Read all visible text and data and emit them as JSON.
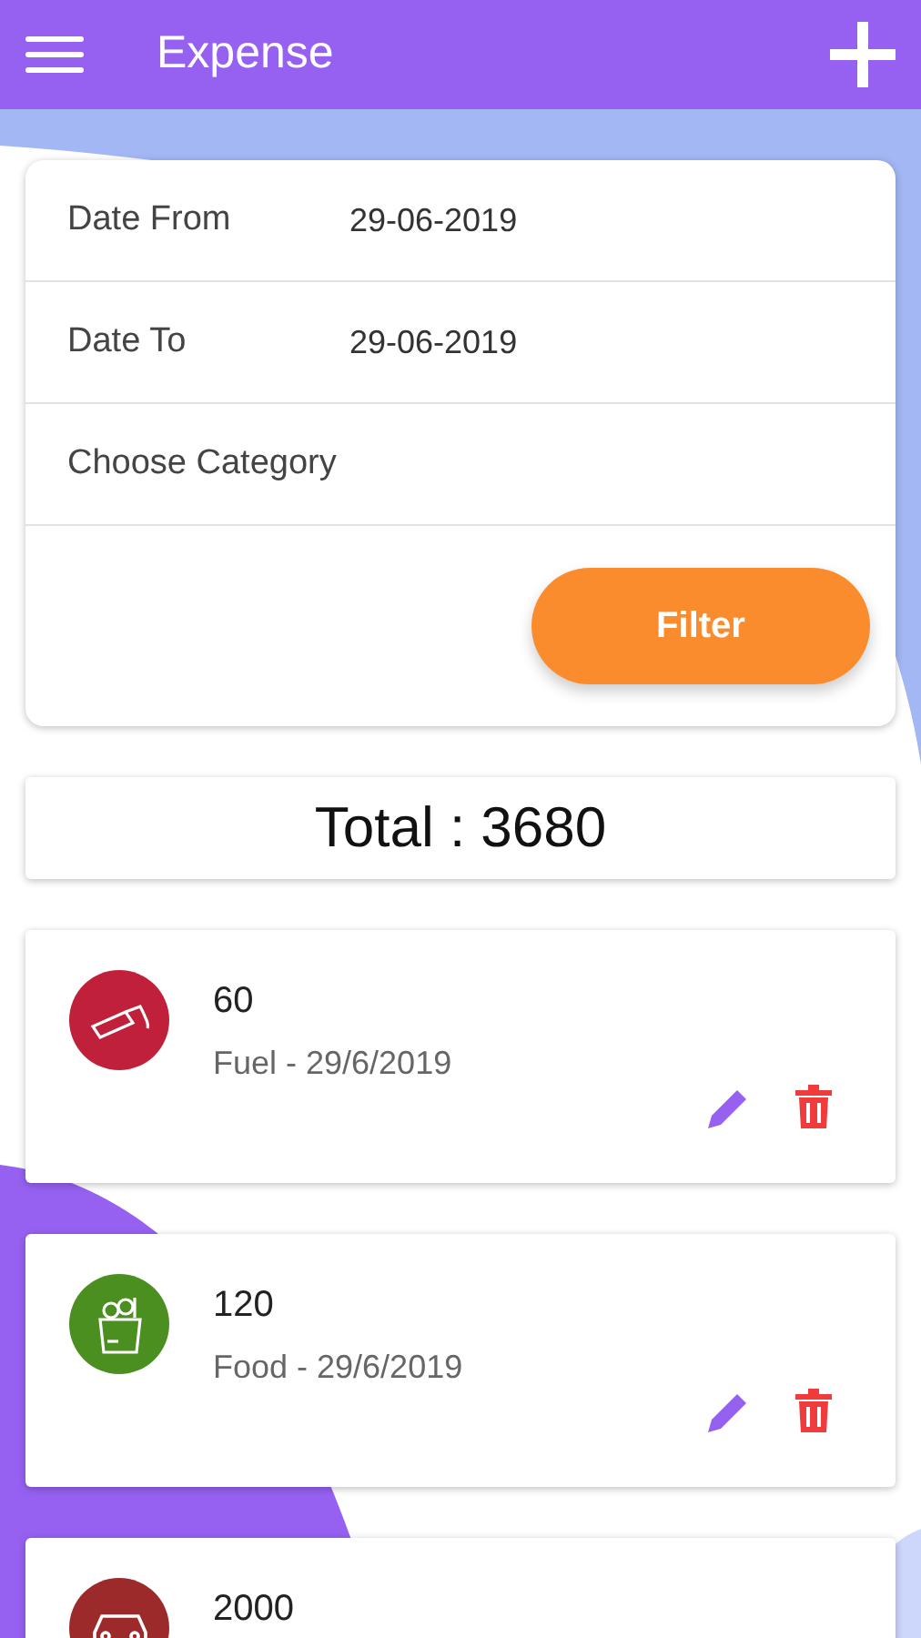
{
  "app_bar": {
    "title": "Expense"
  },
  "filter": {
    "fields": [
      {
        "label": "Date From",
        "value": "29-06-2019"
      },
      {
        "label": "Date To",
        "value": "29-06-2019"
      },
      {
        "label": "Choose Category"
      }
    ],
    "button": "Filter"
  },
  "total": "Total : 3680",
  "expenses": [
    {
      "amount": "60",
      "detail": "Fuel - 29/6/2019",
      "kind": "fuel",
      "color": "#c0203a"
    },
    {
      "amount": "120",
      "detail": "Food - 29/6/2019",
      "kind": "food",
      "color": "#4a8f1f"
    },
    {
      "amount": "2000",
      "kind": "car",
      "color": "#9c2a2a"
    }
  ]
}
